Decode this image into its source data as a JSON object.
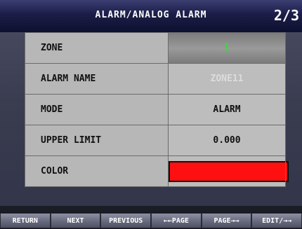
{
  "header": {
    "title": "ALARM/ANALOG ALARM",
    "page": "2/3"
  },
  "rows": [
    {
      "label": "ZONE",
      "value": "1"
    },
    {
      "label": "ALARM NAME",
      "value": "ZONE11"
    },
    {
      "label": "MODE",
      "value": "ALARM"
    },
    {
      "label": "UPPER LIMIT",
      "value": "0.000"
    },
    {
      "label": "COLOR",
      "value_color": "#ff1010"
    }
  ],
  "buttons": {
    "return": "RETURN",
    "next": "NEXT",
    "previous": "PREVIOUS",
    "page_back": "←←PAGE",
    "page_forward": "PAGE→→",
    "edit": "EDIT/→→"
  },
  "colors": {
    "zone_value": "#31e031",
    "color_swatch": "#ff1010"
  }
}
